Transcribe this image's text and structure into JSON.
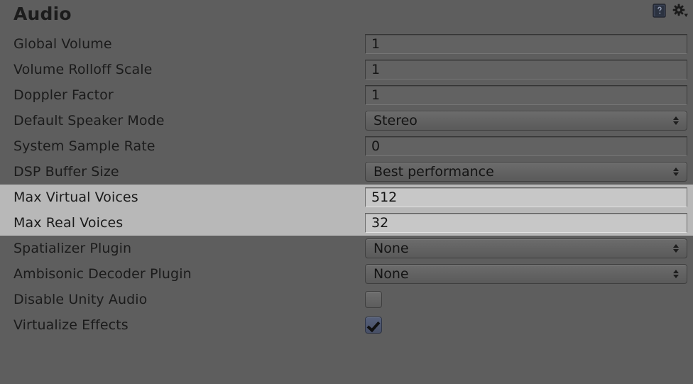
{
  "header": {
    "title": "Audio",
    "help_icon": "help-book-icon",
    "settings_icon": "gear-dropdown-icon"
  },
  "rows": [
    {
      "label": "Global Volume",
      "type": "text",
      "value": "1",
      "highlight": false
    },
    {
      "label": "Volume Rolloff Scale",
      "type": "text",
      "value": "1",
      "highlight": false
    },
    {
      "label": "Doppler Factor",
      "type": "text",
      "value": "1",
      "highlight": false
    },
    {
      "label": "Default Speaker Mode",
      "type": "dropdown",
      "value": "Stereo",
      "highlight": false
    },
    {
      "label": "System Sample Rate",
      "type": "text",
      "value": "0",
      "highlight": false
    },
    {
      "label": "DSP Buffer Size",
      "type": "dropdown",
      "value": "Best performance",
      "highlight": false
    },
    {
      "label": "Max Virtual Voices",
      "type": "text",
      "value": "512",
      "highlight": true
    },
    {
      "label": "Max Real Voices",
      "type": "text",
      "value": "32",
      "highlight": true
    },
    {
      "label": "Spatializer Plugin",
      "type": "dropdown",
      "value": "None",
      "highlight": false
    },
    {
      "label": "Ambisonic Decoder Plugin",
      "type": "dropdown",
      "value": "None",
      "highlight": false
    },
    {
      "label": "Disable Unity Audio",
      "type": "checkbox",
      "checked": false,
      "highlight": false
    },
    {
      "label": "Virtualize Effects",
      "type": "checkbox",
      "checked": true,
      "highlight": false
    }
  ],
  "colors": {
    "background": "#5e5e5e",
    "row_highlight": "#b8b8b8",
    "text": "#1b1b1b",
    "checkbox_checked": "#4d5568"
  }
}
